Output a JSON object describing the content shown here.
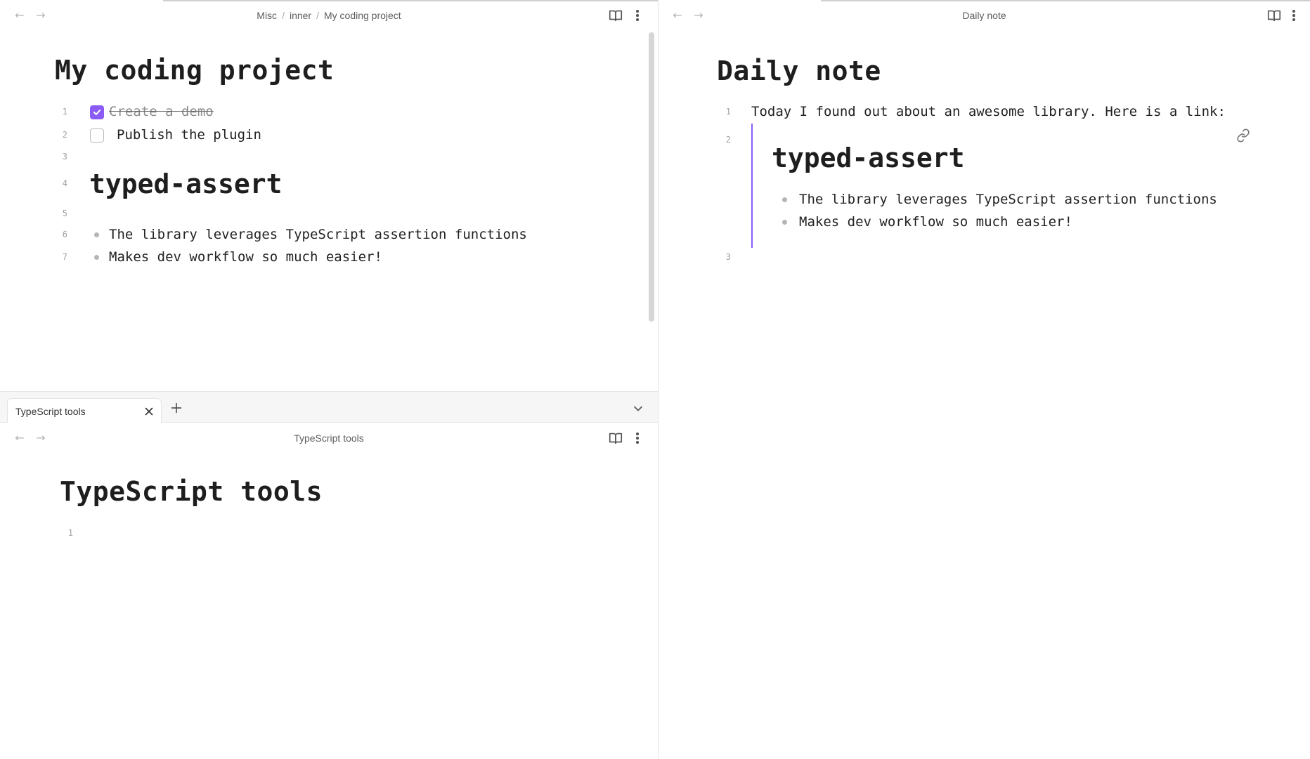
{
  "left_top": {
    "breadcrumb": [
      "Misc",
      "inner",
      "My coding project"
    ],
    "breadcrumb_sep": "/",
    "title": "My coding project",
    "lines": [
      {
        "num": "1",
        "text": "Create a demo",
        "checked": true
      },
      {
        "num": "2",
        "text": "Publish the plugin",
        "checked": false
      },
      {
        "num": "3"
      },
      {
        "num": "4",
        "text": "typed-assert"
      },
      {
        "num": "5"
      },
      {
        "num": "6",
        "text": "The library leverages TypeScript assertion functions"
      },
      {
        "num": "7",
        "text": "Makes dev workflow so much easier!"
      }
    ]
  },
  "right": {
    "header_title": "Daily note",
    "title": "Daily note",
    "lines": [
      {
        "num": "1",
        "text": "Today I found out about an awesome library. Here is a link:"
      },
      {
        "num": "2"
      },
      {
        "num": "3"
      }
    ],
    "embed": {
      "heading": "typed-assert",
      "items": [
        "The library leverages TypeScript assertion functions",
        "Makes dev workflow so much easier!"
      ]
    }
  },
  "left_bottom": {
    "tab_label": "TypeScript tools",
    "header_title": "TypeScript tools",
    "title": "TypeScript tools",
    "lines": [
      {
        "num": "1"
      }
    ]
  },
  "icons": {
    "back": "arrow-left-icon",
    "forward": "arrow-right-icon",
    "reading_view": "book-open-icon",
    "more": "more-vertical-icon",
    "close": "close-icon",
    "new_tab": "plus-icon",
    "tab_list": "chevron-down-icon",
    "embed_link": "link-icon",
    "check": "check-icon"
  },
  "colors": {
    "accent": "#8a5cf5",
    "line_number": "#a0a0a0",
    "header_text": "#5c5c5c"
  }
}
